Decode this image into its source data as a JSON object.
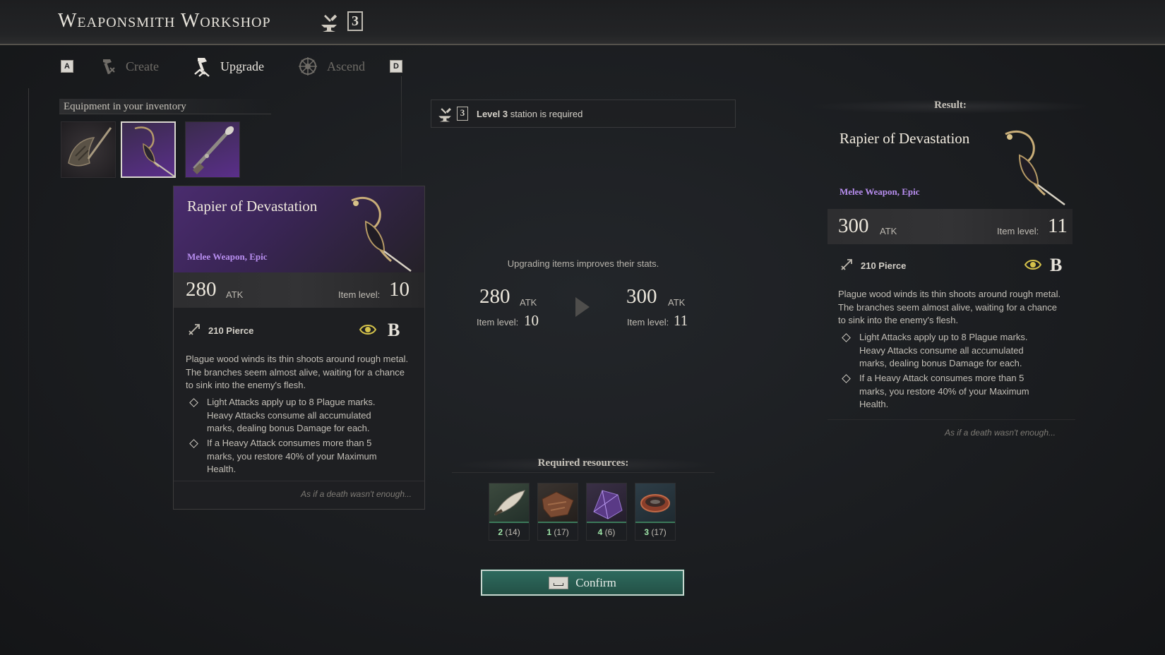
{
  "header": {
    "title": "Weaponsmith Workshop",
    "station_level": "3"
  },
  "tabs": {
    "prev_key": "A",
    "next_key": "D",
    "items": [
      {
        "label": "Create",
        "active": false
      },
      {
        "label": "Upgrade",
        "active": true
      },
      {
        "label": "Ascend",
        "active": false
      }
    ]
  },
  "inventory": {
    "title": "Equipment in your inventory",
    "items": [
      {
        "name": "axe-weapon-icon",
        "selected": false
      },
      {
        "name": "rapier-weapon-icon",
        "selected": true
      },
      {
        "name": "blunderbuss-weapon-icon",
        "selected": false
      }
    ]
  },
  "current_item": {
    "name": "Rapier of Devastation",
    "category": "Melee Weapon, Epic",
    "atk": "280",
    "atk_label": "ATK",
    "item_level_label": "Item level:",
    "item_level": "10",
    "damage": "210 Pierce",
    "grade": "B",
    "description": "Plague wood winds its thin shoots around rough metal. The branches seem almost alive, waiting for a chance to sink into the enemy's flesh.",
    "perks": [
      "Light Attacks apply up to 8 Plague marks. Heavy Attacks consume all accumulated marks, dealing bonus Damage for each.",
      "If a Heavy Attack consumes more than 5 marks, you restore 40% of your Maximum Health."
    ],
    "flavor": "As if a death wasn't enough..."
  },
  "center": {
    "requirement_level": "Level 3",
    "requirement_text": " station is required",
    "note": "Upgrading items improves their stats.",
    "from": {
      "atk": "280",
      "atk_label": "ATK",
      "level_label": "Item level:",
      "level": "10"
    },
    "to": {
      "atk": "300",
      "atk_label": "ATK",
      "level_label": "Item level:",
      "level": "11"
    },
    "resources_title": "Required resources:",
    "resources": [
      {
        "name": "blade-resource-icon",
        "need": "2",
        "have": "(14)"
      },
      {
        "name": "leather-resource-icon",
        "need": "1",
        "have": "(17)"
      },
      {
        "name": "crystal-resource-icon",
        "need": "4",
        "have": "(6)"
      },
      {
        "name": "bowl-resource-icon",
        "need": "3",
        "have": "(17)"
      }
    ],
    "confirm_label": "Confirm"
  },
  "result": {
    "title": "Result:",
    "name": "Rapier of Devastation",
    "category": "Melee Weapon, Epic",
    "atk": "300",
    "atk_label": "ATK",
    "item_level_label": "Item level:",
    "item_level": "11",
    "damage": "210 Pierce",
    "grade": "B",
    "description": "Plague wood winds its thin shoots around rough metal. The branches seem almost alive, waiting for a chance to sink into the enemy's flesh.",
    "perks": [
      "Light Attacks apply up to 8 Plague marks. Heavy Attacks consume all accumulated marks, dealing bonus Damage for each.",
      "If a Heavy Attack consumes more than 5 marks, you restore 40% of your Maximum Health."
    ],
    "flavor": "As if a death wasn't enough..."
  },
  "colors": {
    "accent_purple": "#b88ef0",
    "confirm_green": "#2e6a5e",
    "resource_ok": "#9fe7a9"
  }
}
